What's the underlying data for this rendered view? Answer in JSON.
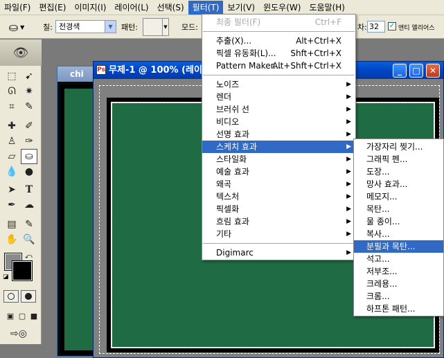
{
  "menubar": {
    "items": [
      "파일(F)",
      "편집(E)",
      "이미지(I)",
      "레이어(L)",
      "선택(S)",
      "필터(T)",
      "보기(V)",
      "윈도우(W)",
      "도움말(H)"
    ],
    "active_index": 5
  },
  "options": {
    "fill_label": "칠:",
    "fill_value": "전경색",
    "pattern_label": "패턴:",
    "mode_label": "모드:",
    "tolerance_label": "차:",
    "tolerance_value": "32",
    "antialias_label": "앤티 앨리어스",
    "antialias_checked": true
  },
  "doc_back": {
    "title": "chi"
  },
  "doc_main": {
    "title": "무제-1 @ 100% (레이",
    "canvas_color": "#1f6b44"
  },
  "filter_menu": {
    "items": [
      {
        "label": "최종 필터(F)",
        "shortcut": "Ctrl+F",
        "disabled": true
      },
      {
        "sep": true
      },
      {
        "label": "추출(X)...",
        "shortcut": "Alt+Ctrl+X"
      },
      {
        "label": "픽셀 유동화(L)...",
        "shortcut": "Shft+Ctrl+X"
      },
      {
        "label": "Pattern Maker...",
        "shortcut": "Alt+Shft+Ctrl+X"
      },
      {
        "sep": true
      },
      {
        "label": "노이즈",
        "submenu": true
      },
      {
        "label": "렌더",
        "submenu": true
      },
      {
        "label": "브러쉬 선",
        "submenu": true
      },
      {
        "label": "비디오",
        "submenu": true
      },
      {
        "label": "선명 효과",
        "submenu": true
      },
      {
        "label": "스케치 효과",
        "submenu": true,
        "highlighted": true
      },
      {
        "label": "스타일화",
        "submenu": true
      },
      {
        "label": "예술 효과",
        "submenu": true
      },
      {
        "label": "왜곡",
        "submenu": true
      },
      {
        "label": "텍스처",
        "submenu": true
      },
      {
        "label": "픽셀화",
        "submenu": true
      },
      {
        "label": "흐림 효과",
        "submenu": true
      },
      {
        "label": "기타",
        "submenu": true
      },
      {
        "sep": true
      },
      {
        "label": "Digimarc",
        "submenu": true
      }
    ]
  },
  "sketch_menu": {
    "items": [
      {
        "label": "가장자리 찢기..."
      },
      {
        "label": "그래픽 펜..."
      },
      {
        "label": "도장..."
      },
      {
        "label": "망사 효과..."
      },
      {
        "label": "메모지..."
      },
      {
        "label": "목탄..."
      },
      {
        "label": "물 종이..."
      },
      {
        "label": "복사..."
      },
      {
        "label": "분필과 목탄...",
        "highlighted": true
      },
      {
        "label": "석고..."
      },
      {
        "label": "저부조..."
      },
      {
        "label": "크레용..."
      },
      {
        "label": "크롬..."
      },
      {
        "label": "하프톤 패턴..."
      }
    ]
  },
  "toolbox": {
    "foreground_color": "#8a8a8a",
    "background_color": "#000000",
    "tools": [
      "rect-marquee",
      "move",
      "lasso",
      "magic-wand",
      "crop",
      "slice",
      "healing-brush",
      "brush",
      "stamp",
      "history-brush",
      "eraser",
      "paint-bucket",
      "blur",
      "dodge",
      "path-select",
      "type",
      "pen",
      "shape",
      "notes",
      "eyedropper",
      "hand",
      "zoom"
    ],
    "selected_tool": "paint-bucket"
  }
}
